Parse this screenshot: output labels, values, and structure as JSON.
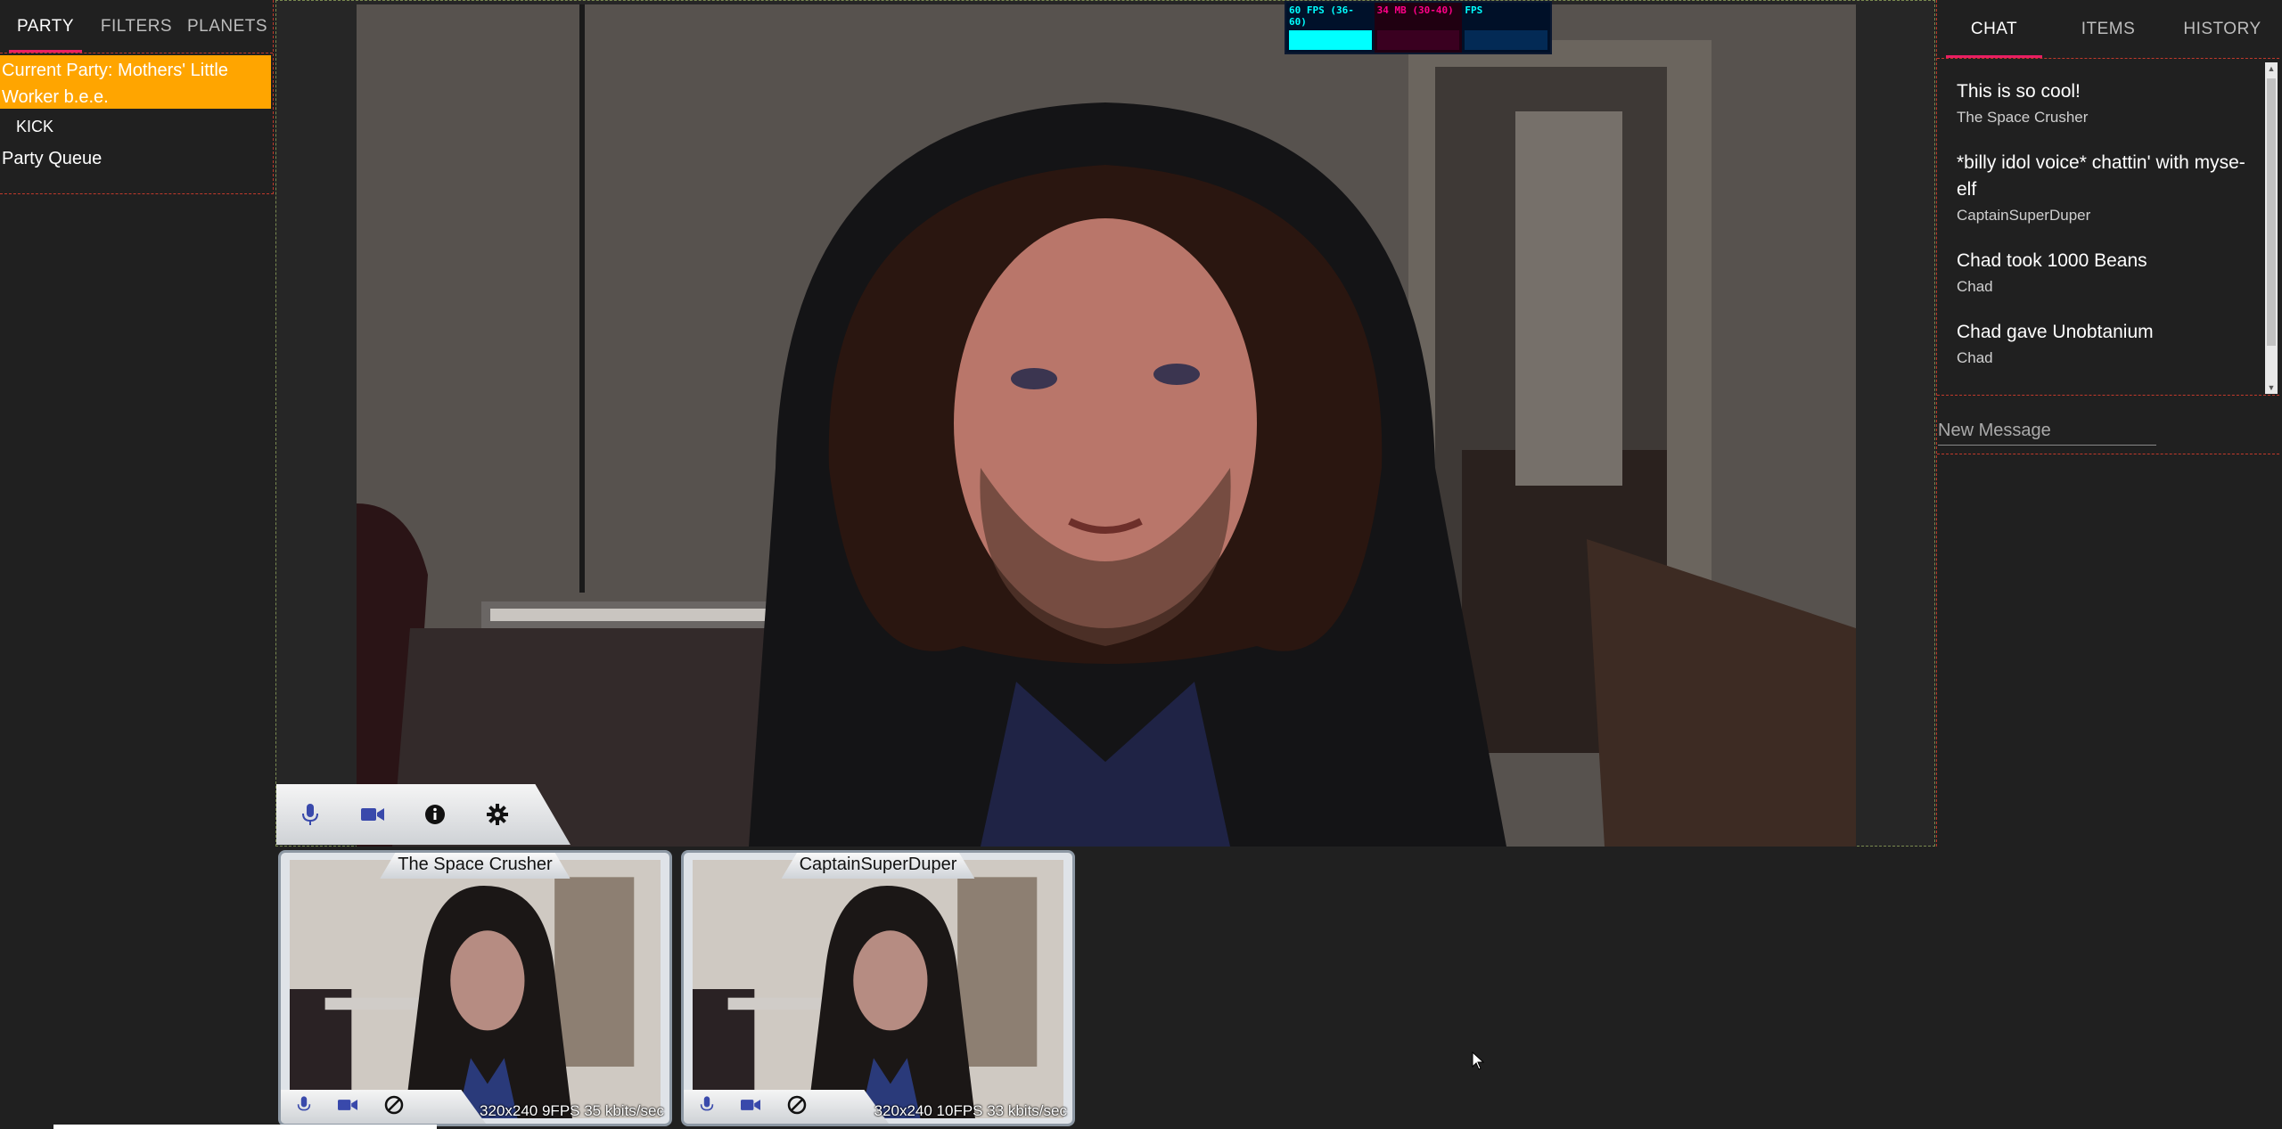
{
  "left_tabs": [
    "PARTY",
    "FILTERS",
    "PLANETS"
  ],
  "party": {
    "current": "Current Party: Mothers' Little Worker b.e.e.",
    "kick_label": "KICK",
    "queue_label": "Party Queue"
  },
  "stats": {
    "fps": "60 FPS (36-60)",
    "mb": "34 MB (30-40)",
    "ms": "FPS"
  },
  "right_tabs": [
    "CHAT",
    "ITEMS",
    "HISTORY"
  ],
  "chat": {
    "messages": [
      {
        "text": "This is so cool!",
        "author": "The Space Crusher"
      },
      {
        "text": "*billy idol voice* chattin' with myse-elf",
        "author": "CaptainSuperDuper"
      },
      {
        "text": "Chad took 1000 Beans",
        "author": "Chad"
      },
      {
        "text": "Chad gave Unobtanium",
        "author": "Chad"
      }
    ],
    "input_placeholder": "New Message"
  },
  "participants": [
    {
      "name": "The Space Crusher",
      "stats": "320x240 9FPS 35 kbits/sec"
    },
    {
      "name": "CaptainSuperDuper",
      "stats": "320x240 10FPS 33 kbits/sec"
    }
  ],
  "colors": {
    "accent": "#e91e63",
    "highlight": "#ffa500",
    "background": "#202020",
    "mic_icon": "#3949ab"
  },
  "icons": [
    "mic-icon",
    "camera-icon",
    "info-icon",
    "settings-icon",
    "block-icon"
  ]
}
